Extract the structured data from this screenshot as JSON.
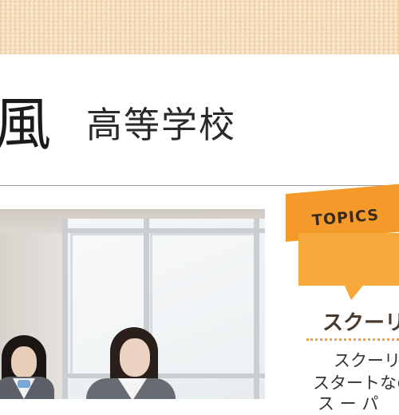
{
  "header": {
    "school_name_fragment": "風",
    "school_type": "高等学校"
  },
  "topics": {
    "tab_label": "TOPICS",
    "heading": "スクーリ",
    "lines": [
      "スクーリン",
      "スタートなの",
      "ス ー パ"
    ]
  },
  "colors": {
    "accent_orange": "#f39a2a",
    "bubble_orange": "#f6a83b"
  }
}
